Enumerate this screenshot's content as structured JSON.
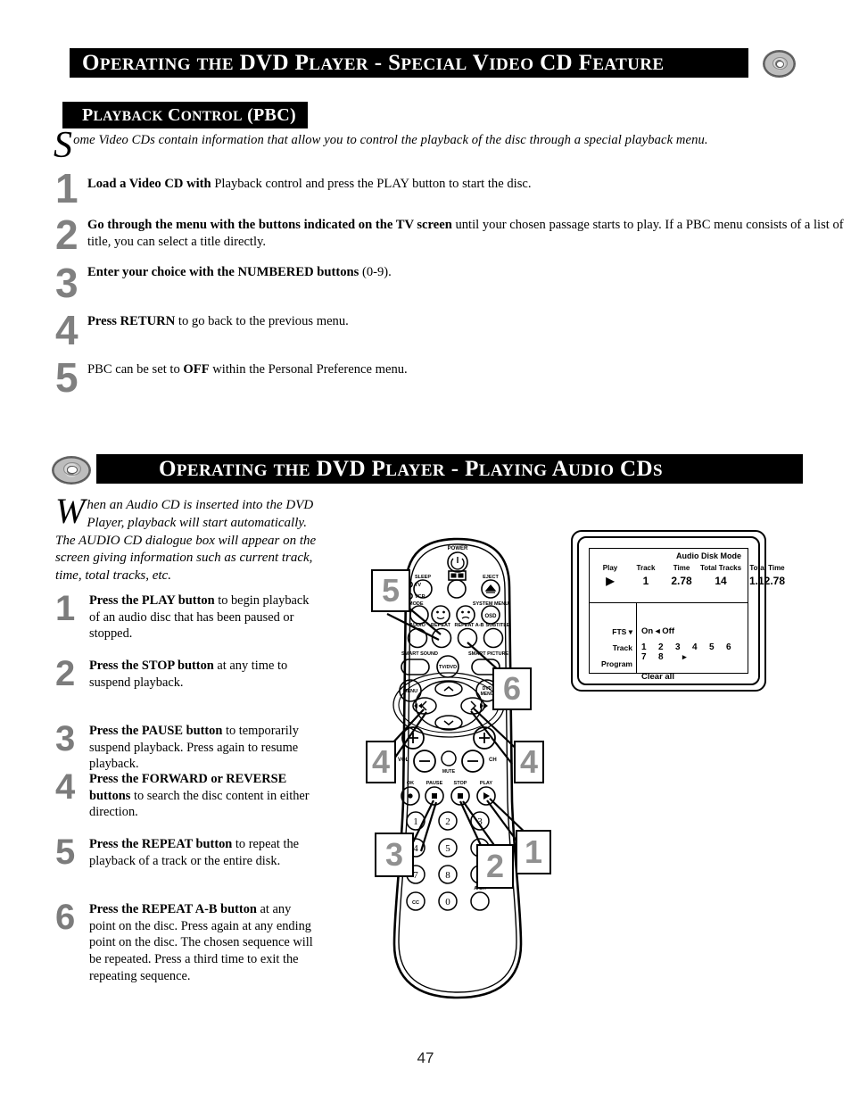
{
  "page": {
    "number": "47"
  },
  "section1": {
    "header": {
      "parts": [
        {
          "big": "O",
          "small": "PERATING"
        },
        {
          "big": " ",
          "small": "THE"
        },
        {
          "big": "DVD",
          "small": ""
        },
        {
          "big": "P",
          "small": "LAYER"
        },
        {
          "big": " - ",
          "small": ""
        },
        {
          "big": "S",
          "small": "PECIAL"
        },
        {
          "big": "V",
          "small": "IDEO"
        },
        {
          "big": "CD",
          "small": ""
        },
        {
          "big": "F",
          "small": "EATURE"
        }
      ],
      "text": "OPERATING THE DVD PLAYER - SPECIAL VIDEO CD FEATURE",
      "icon": "cd-disc-icon"
    },
    "subheader": {
      "text": "PLAYBACK CONTROL (PBC)"
    },
    "intro": {
      "dropcap": "S",
      "rest": "ome Video CDs contain information that allow you to control the playback of the disc through a special playback menu."
    },
    "steps": [
      {
        "num": "1",
        "bold": "Load a Video CD with",
        "rest": " Playback control and press the PLAY button to start the disc."
      },
      {
        "num": "2",
        "bold": "Go through the menu with the buttons indicated on the TV screen",
        "rest": " until your chosen passage starts to play. If a PBC menu consists of a list of title, you can select a title directly."
      },
      {
        "num": "3",
        "bold": "Enter your choice with the NUMBERED buttons",
        "rest": " (0-9)."
      },
      {
        "num": "4",
        "bold": "Press RETURN",
        "rest": " to go back to the previous menu."
      },
      {
        "num": "5",
        "bold": "",
        "rest": "PBC can be set to ",
        "boldmid": "OFF",
        "tail": " within the Personal Preference menu."
      }
    ]
  },
  "section2": {
    "header": {
      "text": "OPERATING THE DVD PLAYER - PLAYING AUDIO CDS",
      "icon": "cd-disc-icon"
    },
    "intro": {
      "dropcap": "W",
      "rest": "hen an Audio CD is inserted into the DVD Player, playback will start automatically. The AUDIO CD dialogue box will appear on the screen giving information such as current track, time, total tracks, etc."
    },
    "steps": [
      {
        "num": "1",
        "bold": "Press the PLAY button",
        "rest": " to begin playback of an audio disc that has been paused or stopped."
      },
      {
        "num": "2",
        "bold": "Press the STOP button",
        "rest": " at any time to suspend playback."
      },
      {
        "num": "3",
        "bold": "Press the PAUSE button",
        "rest": " to temporarily suspend playback. Press again to resume playback."
      },
      {
        "num": "4",
        "bold": "Press the FORWARD or REVERSE buttons",
        "rest": " to search the disc content in either direction."
      },
      {
        "num": "5",
        "bold": "Press the REPEAT button",
        "rest": " to repeat the playback of a track or the entire disk."
      },
      {
        "num": "6",
        "bold": "Press the REPEAT A-B button",
        "rest": " at any point on the disc. Press again at any ending point on the disc. The chosen sequence will be repeated. Press a third time to exit the repeating sequence."
      }
    ],
    "osd": {
      "mode_title": "Audio Disk Mode",
      "columns": [
        {
          "label": "Play",
          "value": "▶"
        },
        {
          "label": "Track",
          "value": "1"
        },
        {
          "label": "Time",
          "value": "2.78"
        },
        {
          "label": "Total Tracks",
          "value": "14"
        },
        {
          "label": "Total Time",
          "value": "1.12.78"
        }
      ],
      "rows": [
        {
          "label": "FTS",
          "value": "On ◂ Off"
        },
        {
          "label": "Track",
          "value": "1  2  3  4  5  6  7  8",
          "more": "▸"
        },
        {
          "label": "Program",
          "value": ""
        }
      ],
      "tracks": [
        "1",
        "2",
        "3",
        "4",
        "5",
        "6",
        "7",
        "8"
      ],
      "fts_on": "On",
      "fts_off": "Off",
      "clear_all": "Clear all"
    },
    "remote": {
      "labels": {
        "power": "POWER",
        "sleep": "SLEEP",
        "pip": "PIP",
        "eject": "EJECT",
        "tv": "TV",
        "vcr": "VCR",
        "mode": "MODE",
        "system_menu": "SYSTEM MENU",
        "osd": "OSD",
        "audio": "AUDIO",
        "repeat": "REPEAT",
        "repeat_ab": "REPEAT A-B",
        "subtitle": "SUBTITLE",
        "smart_sound": "SMART SOUND",
        "tv_dvd": "TV/DVD",
        "smart_picture": "SMART PICTURE",
        "menu": "MENU",
        "dvd_menu": "DVD MENU",
        "vol": "VOL",
        "ch": "CH",
        "mute": "MUTE",
        "ok": "OK",
        "pause": "PAUSE",
        "stop": "STOP",
        "play": "PLAY",
        "ach": "A/CH",
        "cc": "CC"
      },
      "keypad": [
        "1",
        "2",
        "3",
        "4",
        "5",
        "6",
        "7",
        "8",
        "9",
        "CC",
        "0",
        "A/CH"
      ],
      "callouts": [
        "1",
        "2",
        "3",
        "4",
        "4",
        "5",
        "6"
      ]
    }
  },
  "colors": {
    "bar_bg": "#000000",
    "bar_text": "#ffffff",
    "step_number": "#808080",
    "body_text": "#000000"
  }
}
